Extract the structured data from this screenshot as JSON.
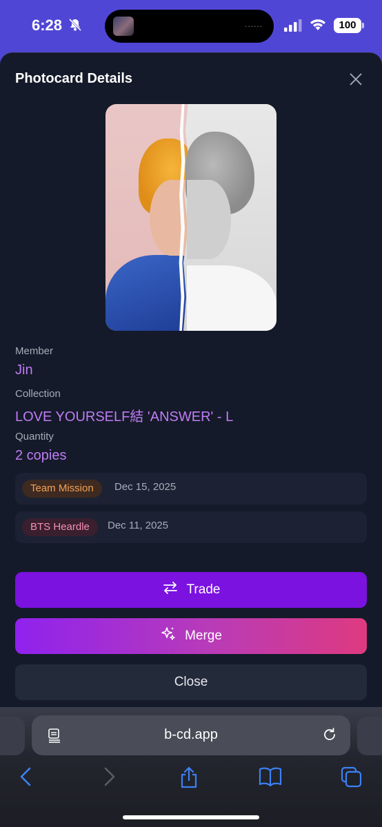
{
  "status_bar": {
    "time": "6:28",
    "battery": "100",
    "island_dots": "......"
  },
  "modal": {
    "title": "Photocard Details",
    "member_label": "Member",
    "member_value": "Jin",
    "collection_label": "Collection",
    "collection_value": "LOVE YOURSELF結 'ANSWER' - L",
    "quantity_label": "Quantity",
    "quantity_value": "2 copies",
    "history": [
      {
        "source": "Team Mission",
        "date": "Dec 15, 2025",
        "color": "#f4a257"
      },
      {
        "source": "BTS Heardle",
        "date": "Dec 11, 2025",
        "color": "#f48fb5"
      }
    ],
    "buttons": {
      "trade": "Trade",
      "merge": "Merge",
      "close": "Close"
    }
  },
  "browser": {
    "url": "b-cd.app"
  },
  "colors": {
    "accent_purple": "#7b12e0",
    "value_text": "#c07cf5",
    "status_bar_bg": "#5046d6",
    "modal_bg": "#141a29"
  },
  "icons": [
    "bell-slash-icon",
    "signal-icon",
    "wifi-icon",
    "close-icon",
    "swap-arrows-icon",
    "sparkles-icon",
    "reader-icon",
    "reload-icon",
    "back-icon",
    "forward-icon",
    "share-icon",
    "bookmarks-icon",
    "tabs-icon"
  ]
}
